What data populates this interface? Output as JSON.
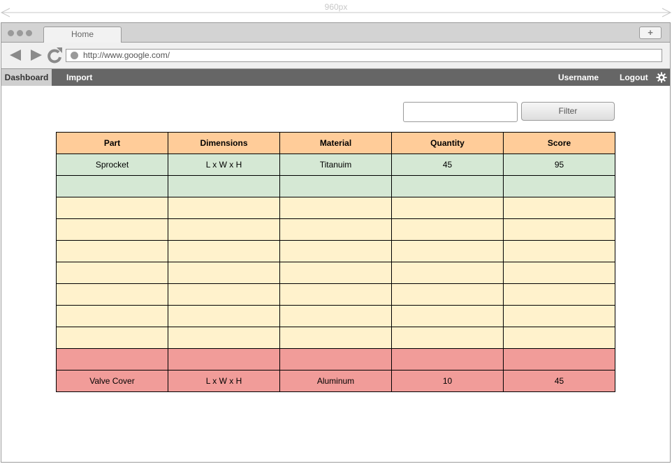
{
  "annotation": {
    "width_label": "960px"
  },
  "browser": {
    "tab_label": "Home",
    "new_tab_label": "+",
    "url": "http://www.google.com/"
  },
  "nav": {
    "active_item": "Dashboard",
    "import_label": "Import",
    "username_label": "Username",
    "logout_label": "Logout"
  },
  "filter": {
    "input_value": "",
    "button_label": "Filter"
  },
  "table": {
    "columns": [
      "Part",
      "Dimensions",
      "Material",
      "Quantity",
      "Score"
    ],
    "rows": [
      {
        "status": "green",
        "cells": [
          "Sprocket",
          "L x W x H",
          "Titanuim",
          "45",
          "95"
        ]
      },
      {
        "status": "green",
        "cells": [
          "",
          "",
          "",
          "",
          ""
        ]
      },
      {
        "status": "yellow",
        "cells": [
          "",
          "",
          "",
          "",
          ""
        ]
      },
      {
        "status": "yellow",
        "cells": [
          "",
          "",
          "",
          "",
          ""
        ]
      },
      {
        "status": "yellow",
        "cells": [
          "",
          "",
          "",
          "",
          ""
        ]
      },
      {
        "status": "yellow",
        "cells": [
          "",
          "",
          "",
          "",
          ""
        ]
      },
      {
        "status": "yellow",
        "cells": [
          "",
          "",
          "",
          "",
          ""
        ]
      },
      {
        "status": "yellow",
        "cells": [
          "",
          "",
          "",
          "",
          ""
        ]
      },
      {
        "status": "yellow",
        "cells": [
          "",
          "",
          "",
          "",
          ""
        ]
      },
      {
        "status": "red",
        "cells": [
          "",
          "",
          "",
          "",
          ""
        ]
      },
      {
        "status": "red",
        "cells": [
          "Valve Cover",
          "L x W x H",
          "Aluminum",
          "10",
          "45"
        ]
      }
    ]
  },
  "colors": {
    "header": "#ffcc99",
    "good": "#d5e8d4",
    "neutral": "#fff2cc",
    "bad": "#f19c99",
    "nav_bar": "#666666"
  },
  "icons": [
    "back-arrow-icon",
    "forward-arrow-icon",
    "reload-icon",
    "gear-icon"
  ]
}
